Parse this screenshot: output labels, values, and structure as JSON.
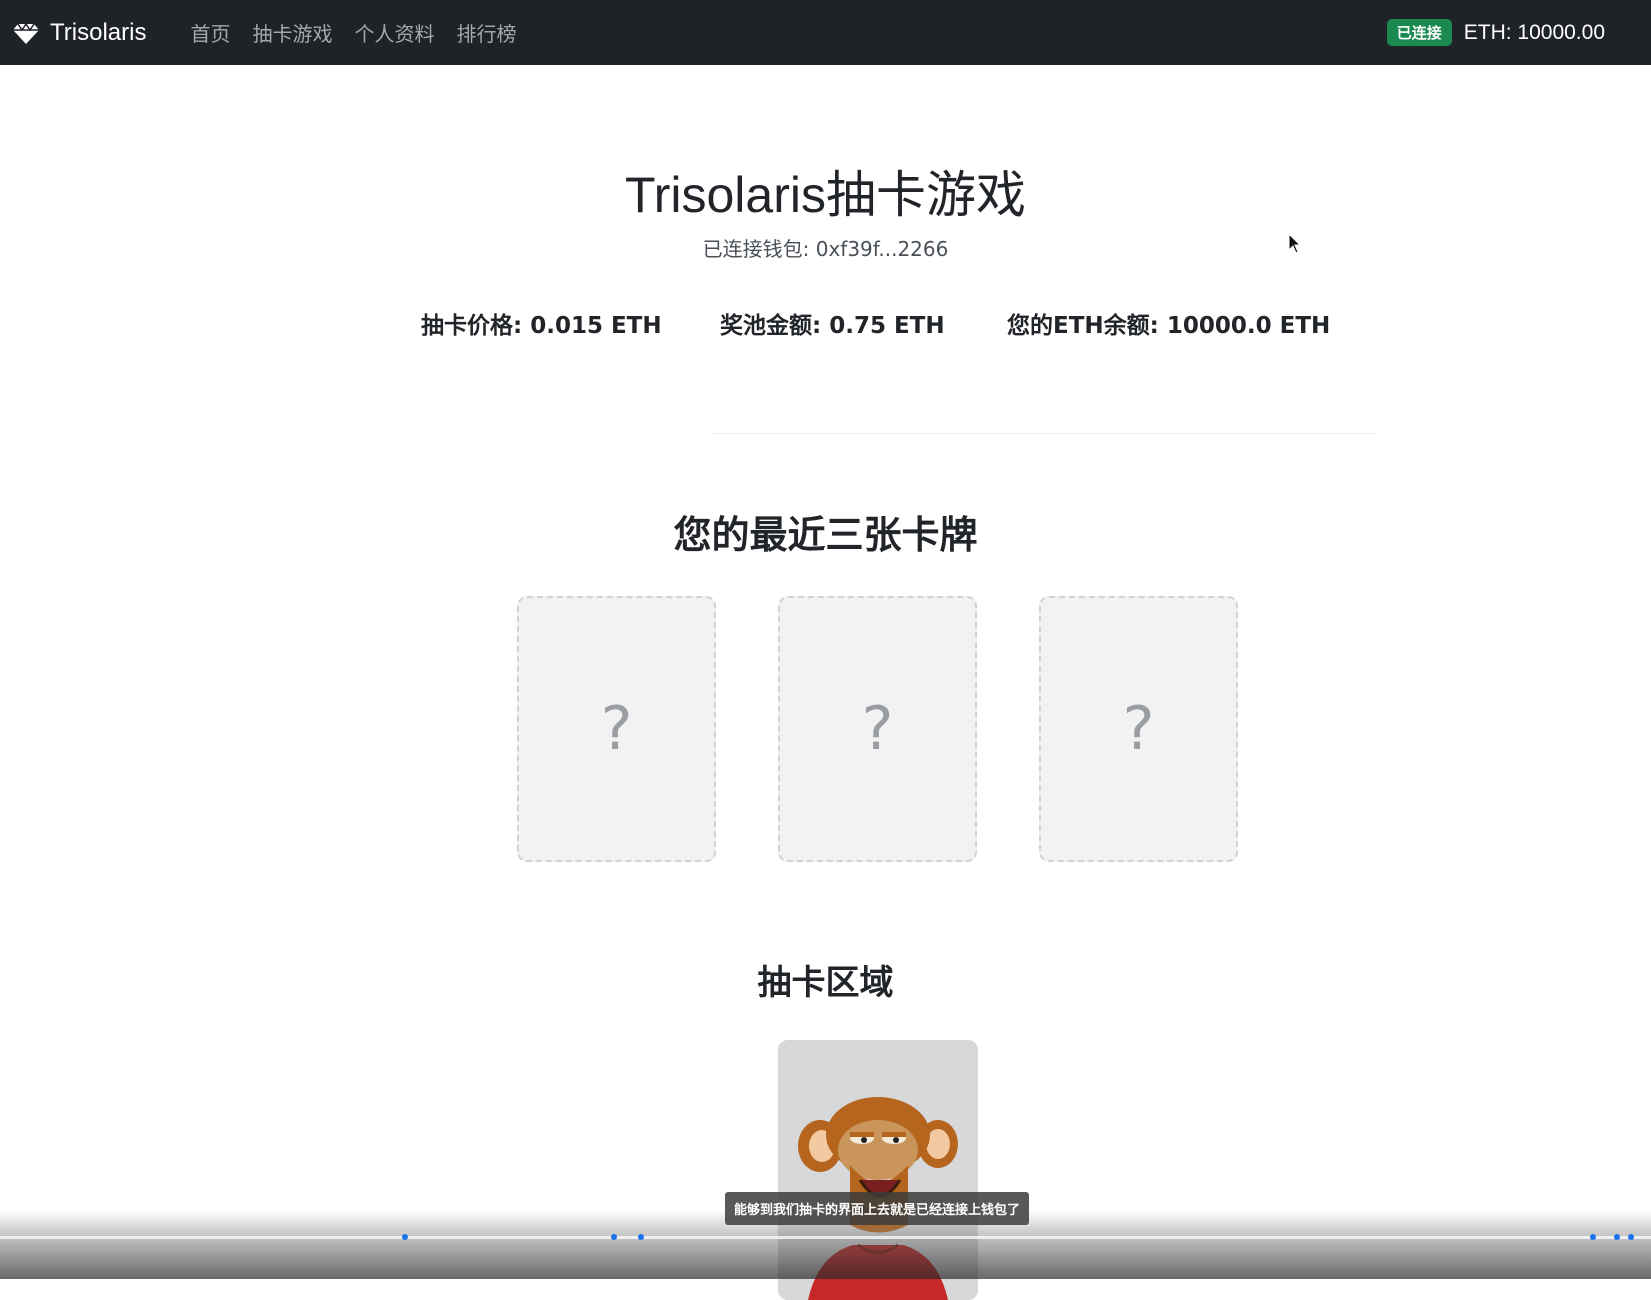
{
  "navbar": {
    "brand": "Trisolaris",
    "brand_icon": "diamond-icon",
    "links": [
      "首页",
      "抽卡游戏",
      "个人资料",
      "排行榜"
    ],
    "status_badge": "已连接",
    "eth_balance": "ETH: 10000.00"
  },
  "main": {
    "title": "Trisolaris抽卡游戏",
    "wallet": "已连接钱包: 0xf39f...2266",
    "stats": {
      "price": "抽卡价格: 0.015 ETH",
      "pool": "奖池金额: 0.75 ETH",
      "balance": "您的ETH余额: 10000.0 ETH"
    },
    "recent_title": "您的最近三张卡牌",
    "recent_cards": [
      "?",
      "?",
      "?"
    ],
    "draw_title": "抽卡区域"
  },
  "video_overlay": {
    "subtitle": "能够到我们抽卡的界面上去就是已经连接上钱包了"
  },
  "colors": {
    "navbar_bg": "#1f2227",
    "badge_bg": "#1a8a50",
    "card_bg": "#f2f2f2"
  }
}
